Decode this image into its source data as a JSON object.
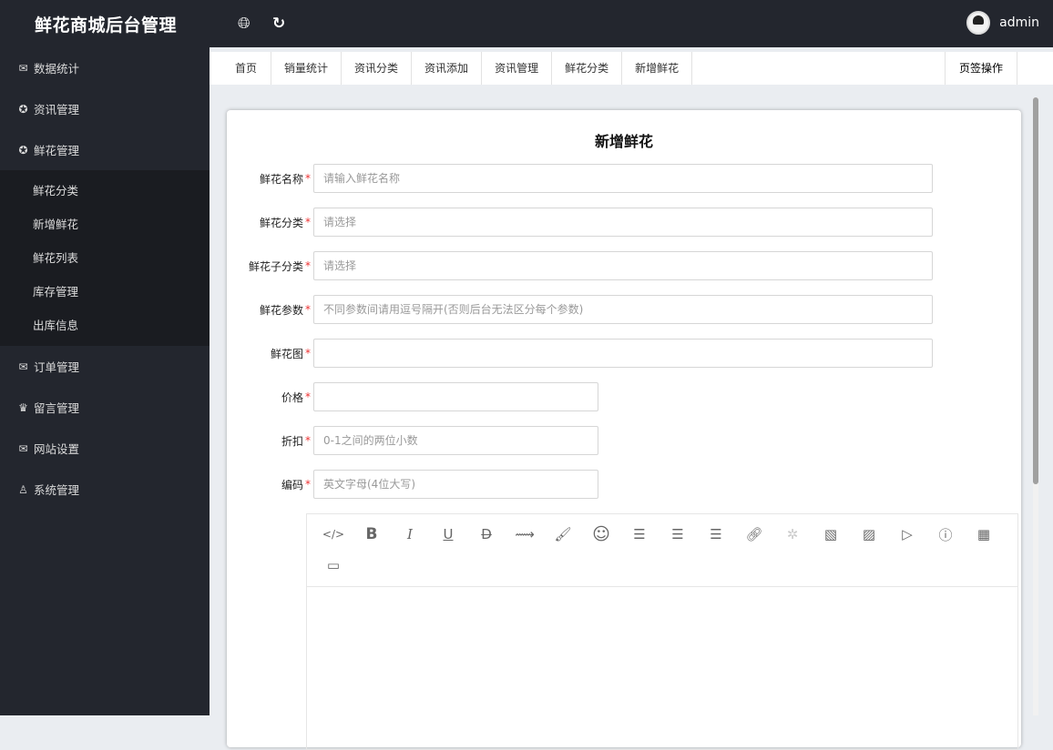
{
  "header": {
    "title": "鲜花商城后台管理",
    "user": "admin",
    "icons": [
      "globe-icon",
      "refresh-icon"
    ]
  },
  "sidebar": {
    "items": [
      {
        "label": "数据统计",
        "icon": "mail-icon"
      },
      {
        "label": "资讯管理",
        "icon": "star-icon"
      },
      {
        "label": "鲜花管理",
        "icon": "star-icon"
      },
      {
        "label": "订单管理",
        "icon": "mail-icon"
      },
      {
        "label": "留言管理",
        "icon": "crown-icon"
      },
      {
        "label": "网站设置",
        "icon": "mail-icon"
      },
      {
        "label": "系统管理",
        "icon": "user-icon"
      }
    ],
    "submenu": [
      "鲜花分类",
      "新增鲜花",
      "鲜花列表",
      "库存管理",
      "出库信息"
    ]
  },
  "tabs": [
    "首页",
    "销量统计",
    "资讯分类",
    "资讯添加",
    "资讯管理",
    "鲜花分类",
    "新增鲜花"
  ],
  "tab_ops": "页签操作",
  "form": {
    "title": "新增鲜花",
    "fields": [
      {
        "label": "鲜花名称",
        "placeholder": "请输入鲜花名称"
      },
      {
        "label": "鲜花分类",
        "placeholder": "请选择"
      },
      {
        "label": "鲜花子分类",
        "placeholder": "请选择"
      },
      {
        "label": "鲜花参数",
        "placeholder": "不同参数间请用逗号隔开(否则后台无法区分每个参数)"
      },
      {
        "label": "鲜花图",
        "placeholder": ""
      },
      {
        "label": "价格",
        "placeholder": ""
      },
      {
        "label": "折扣",
        "placeholder": "0-1之间的两位小数"
      },
      {
        "label": "编码",
        "placeholder": "英文字母(4位大写)"
      }
    ]
  },
  "editor": {
    "tools": [
      "code",
      "bold",
      "italic",
      "underline",
      "strikethrough",
      "line-chart",
      "paint-brush",
      "emoji",
      "align-left",
      "align-center",
      "align-right",
      "link",
      "unlink",
      "image",
      "image-upload",
      "video",
      "info",
      "table",
      "fullscreen"
    ]
  }
}
